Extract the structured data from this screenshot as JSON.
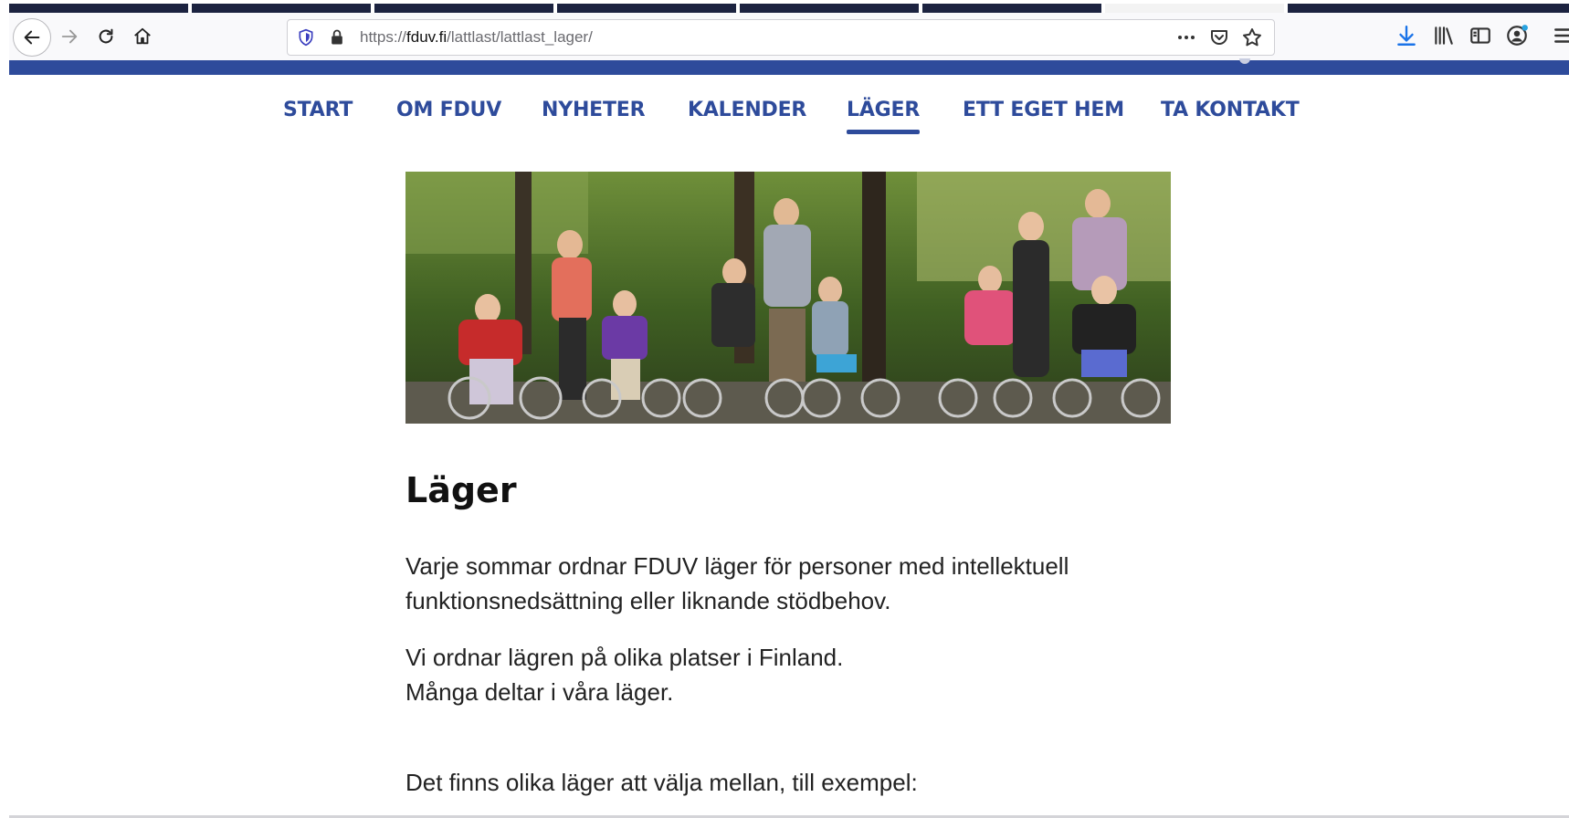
{
  "browser": {
    "url_prefix": "https://",
    "url_host": "fduv.fi",
    "url_path": "/lattlast/lattlast_lager/"
  },
  "nav": {
    "items": [
      "START",
      "OM FDUV",
      "NYHETER",
      "KALENDER",
      "LÄGER",
      "ETT EGET HEM",
      "TA KONTAKT"
    ],
    "active_index": 4
  },
  "page": {
    "title": "Läger",
    "p1_line1": "Varje sommar ordnar FDUV läger för personer med intellektuell",
    "p1_line2": "funktionsnedsättning eller liknande stödbehov.",
    "p2_line1": "Vi ordnar lägren på olika platser i Finland.",
    "p2_line2": "Många deltar i våra läger.",
    "p3": "Det finns olika läger att välja mellan, till exempel:"
  },
  "colors": {
    "brand_blue": "#2e4b9b",
    "toolbar_bg": "#f9f9fb",
    "download_blue": "#1a73e8"
  },
  "icons": [
    "back-arrow-icon",
    "forward-arrow-icon",
    "reload-icon",
    "home-icon",
    "tracking-shield-icon",
    "lock-icon",
    "page-actions-icon",
    "pocket-icon",
    "bookmark-star-icon",
    "download-icon",
    "library-icon",
    "sidebar-icon",
    "account-icon",
    "menu-icon"
  ]
}
